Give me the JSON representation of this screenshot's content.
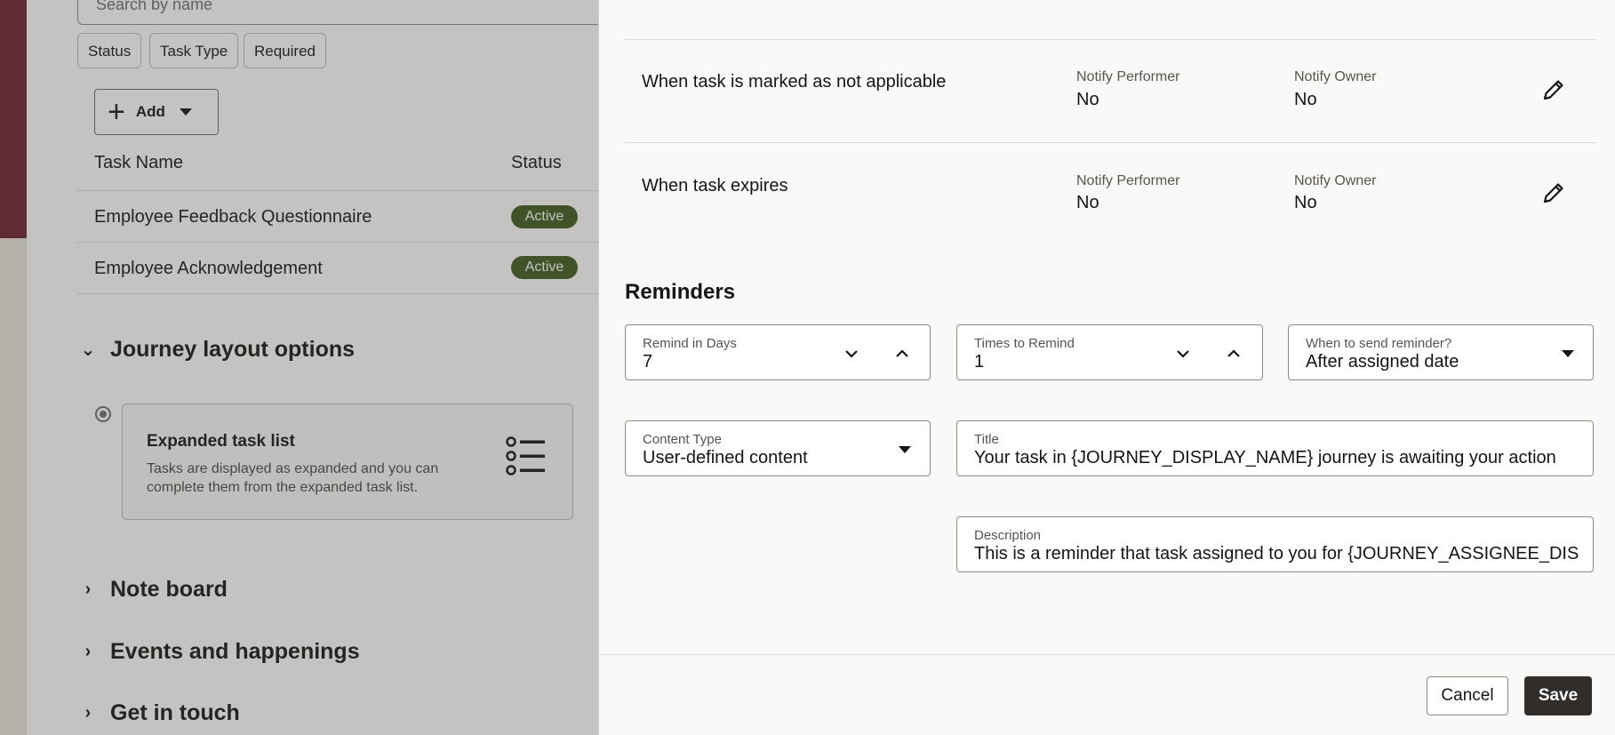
{
  "background": {
    "search_placeholder": "Search by name",
    "filters": [
      "Status",
      "Task Type",
      "Required"
    ],
    "add_label": "Add",
    "table": {
      "headers": [
        "Task Name",
        "Status"
      ],
      "rows": [
        {
          "name": "Employee Feedback Questionnaire",
          "status": "Active"
        },
        {
          "name": "Employee Acknowledgement",
          "status": "Active"
        }
      ]
    },
    "sections": {
      "layout_options": "Journey layout options",
      "note_board": "Note board",
      "events": "Events and happenings",
      "get_in_touch": "Get in touch"
    },
    "layout_card": {
      "title": "Expanded task list",
      "description": "Tasks are displayed as expanded and you can complete them from the expanded task list."
    }
  },
  "drawer": {
    "notifications": [
      {
        "title": "When task is marked as not applicable",
        "performer_label": "Notify Performer",
        "performer_value": "No",
        "owner_label": "Notify Owner",
        "owner_value": "No"
      },
      {
        "title": "When task expires",
        "performer_label": "Notify Performer",
        "performer_value": "No",
        "owner_label": "Notify Owner",
        "owner_value": "No"
      }
    ],
    "reminders": {
      "heading": "Reminders",
      "remind_in_days": {
        "label": "Remind in Days",
        "value": "7"
      },
      "times_to_remind": {
        "label": "Times to Remind",
        "value": "1"
      },
      "when_to_send": {
        "label": "When to send reminder?",
        "value": "After assigned date"
      },
      "content_type": {
        "label": "Content Type",
        "value": "User-defined content"
      },
      "title": {
        "label": "Title",
        "value": "Your task in {JOURNEY_DISPLAY_NAME} journey is awaiting your action"
      },
      "description": {
        "label": "Description",
        "value": "This is a reminder that task assigned to you for {JOURNEY_ASSIGNEE_DISPLAY_NAME"
      }
    },
    "footer": {
      "cancel_label": "Cancel",
      "save_label": "Save"
    }
  }
}
